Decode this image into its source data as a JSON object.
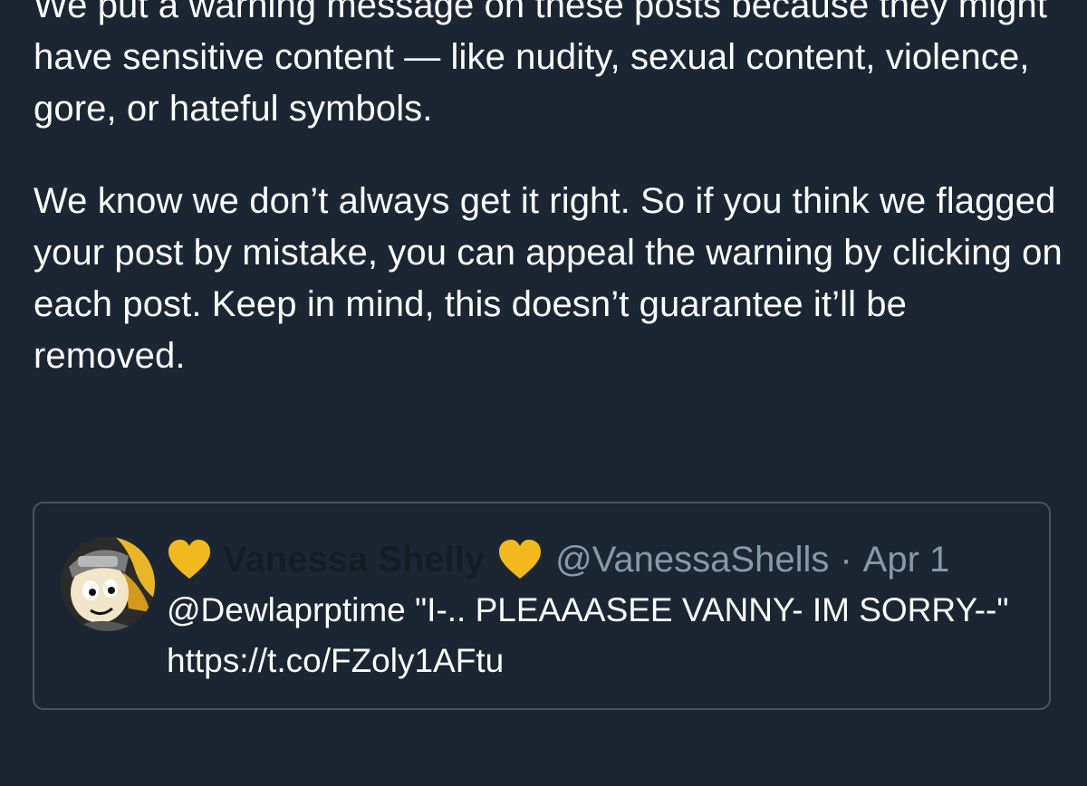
{
  "notice": {
    "paragraph_1": "We put a warning message on these posts because they might have sensitive content — like nudity, sexual content, violence, gore, or hateful symbols.",
    "paragraph_2": "We know we don’t always get it right. So if you think we flagged your post by mistake, you can appeal the warning by clicking on each post. Keep in mind, this doesn’t guarantee it’ll be removed."
  },
  "quoted_tweet": {
    "display_name": "Vanessa Shelly",
    "name_emoji": "yellow-heart-icon",
    "handle": "@VanessaShells",
    "separator": "·",
    "date": "Apr 1",
    "text": "@Dewlaprptime \"I-.. PLEAAASEE VANNY- IM SORRY--\" https://t.co/FZoly1AFtu"
  },
  "colors": {
    "background": "#1c2633",
    "text": "#ffffff",
    "muted": "#8899a6",
    "border": "#4a5460",
    "heart": "#f2b91e"
  }
}
